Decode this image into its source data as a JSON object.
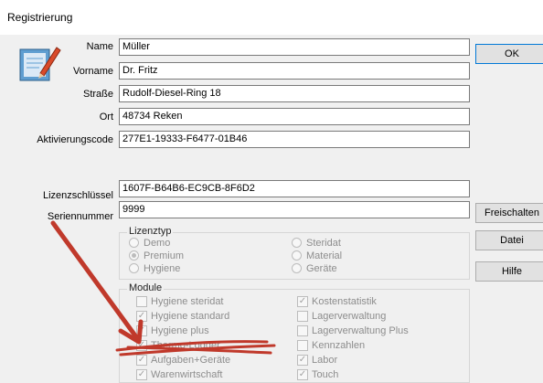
{
  "window": {
    "title": "Registrierung"
  },
  "form": {
    "name": {
      "label": "Name",
      "value": "Müller"
    },
    "vorname": {
      "label": "Vorname",
      "value": "Dr. Fritz"
    },
    "strasse": {
      "label": "Straße",
      "value": "Rudolf-Diesel-Ring 18"
    },
    "ort": {
      "label": "Ort",
      "value": "48734 Reken"
    },
    "aktivierungscode": {
      "label": "Aktivierungscode",
      "value": "277E1-19333-F6477-01B46"
    },
    "lizenzschluessel": {
      "label": "Lizenzschlüssel",
      "value": "1607F-B64B6-EC9CB-8F6D2"
    },
    "seriennummer": {
      "label": "Seriennummer",
      "value": "9999"
    }
  },
  "buttons": {
    "ok": "OK",
    "freischalten": "Freischalten",
    "datei": "Datei",
    "hilfe": "Hilfe"
  },
  "lizenztyp": {
    "title": "Lizenztyp",
    "options": [
      {
        "label": "Demo",
        "checked": false
      },
      {
        "label": "Premium",
        "checked": true
      },
      {
        "label": "Hygiene",
        "checked": false
      },
      {
        "label": "Steridat",
        "checked": false
      },
      {
        "label": "Material",
        "checked": false
      },
      {
        "label": "Geräte",
        "checked": false
      }
    ]
  },
  "module": {
    "title": "Module",
    "items": [
      {
        "label": "Hygiene steridat",
        "checked": false
      },
      {
        "label": "Hygiene standard",
        "checked": true
      },
      {
        "label": "Hygiene plus",
        "checked": true
      },
      {
        "label": "Thermo-Logger",
        "checked": true
      },
      {
        "label": "Aufgaben+Geräte",
        "checked": true
      },
      {
        "label": "Warenwirtschaft",
        "checked": true
      },
      {
        "label": "Kostenstatistik",
        "checked": true
      },
      {
        "label": "Lagerverwaltung",
        "checked": false
      },
      {
        "label": "Lagerverwaltung Plus",
        "checked": false
      },
      {
        "label": "Kennzahlen",
        "checked": false
      },
      {
        "label": "Labor",
        "checked": true
      },
      {
        "label": "Touch",
        "checked": true
      }
    ]
  },
  "colors": {
    "annotation": "#c0392b"
  }
}
